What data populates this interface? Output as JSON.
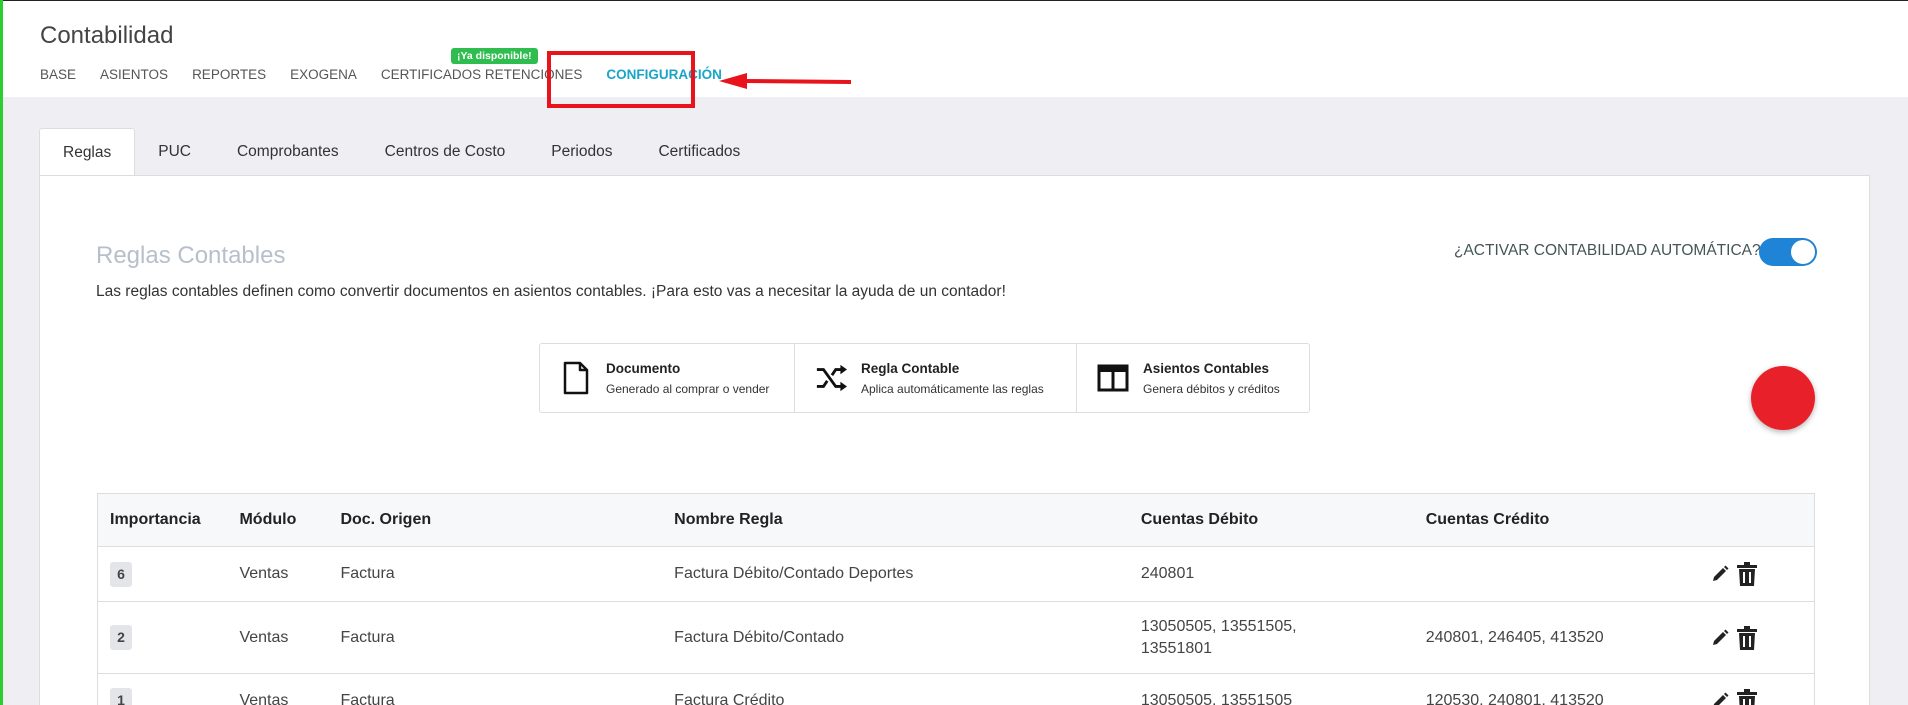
{
  "app": {
    "title": "Contabilidad"
  },
  "main_nav": {
    "items": [
      {
        "label": "BASE"
      },
      {
        "label": "ASIENTOS"
      },
      {
        "label": "REPORTES"
      },
      {
        "label": "EXOGENA"
      },
      {
        "label": "CERTIFICADOS RETENCIONES"
      },
      {
        "label": "CONFIGURACIÓN"
      }
    ],
    "badge": "¡Ya disponible!",
    "active_index": 5
  },
  "tabs": [
    {
      "label": "Reglas"
    },
    {
      "label": "PUC"
    },
    {
      "label": "Comprobantes"
    },
    {
      "label": "Centros de Costo"
    },
    {
      "label": "Periodos"
    },
    {
      "label": "Certificados"
    }
  ],
  "section": {
    "title": "Reglas Contables",
    "description": "Las reglas contables definen como convertir documentos en asientos contables. ¡Para esto vas a necesitar la ayuda de un contador!"
  },
  "auto_toggle": {
    "label": "¿ACTIVAR CONTABILIDAD AUTOMÁTICA?",
    "on": true
  },
  "flow": [
    {
      "title": "Documento",
      "subtitle": "Generado al comprar o vender",
      "icon": "document-icon"
    },
    {
      "title": "Regla Contable",
      "subtitle": "Aplica automáticamente las reglas",
      "icon": "shuffle-icon"
    },
    {
      "title": "Asientos Contables",
      "subtitle": "Genera débitos y créditos",
      "icon": "columns-icon"
    }
  ],
  "table": {
    "headers": [
      "Importancia",
      "Módulo",
      "Doc. Origen",
      "Nombre Regla",
      "Cuentas Débito",
      "Cuentas Crédito",
      ""
    ],
    "rows": [
      {
        "importance": "6",
        "module": "Ventas",
        "doc": "Factura",
        "name": "Factura Débito/Contado Deportes",
        "debit": "240801",
        "credit": ""
      },
      {
        "importance": "2",
        "module": "Ventas",
        "doc": "Factura",
        "name": "Factura Débito/Contado",
        "debit": "13050505, 13551505, 13551801",
        "credit": "240801, 246405, 413520"
      },
      {
        "importance": "1",
        "module": "Ventas",
        "doc": "Factura",
        "name": "Factura Crédito",
        "debit": "13050505, 13551505",
        "credit": "120530, 240801, 413520"
      }
    ]
  },
  "colors": {
    "accent": "#18a5c8",
    "toggle": "#1f83d6",
    "highlight": "#e8131b",
    "badge": "#2ebd4e",
    "fab": "#e8202a"
  }
}
